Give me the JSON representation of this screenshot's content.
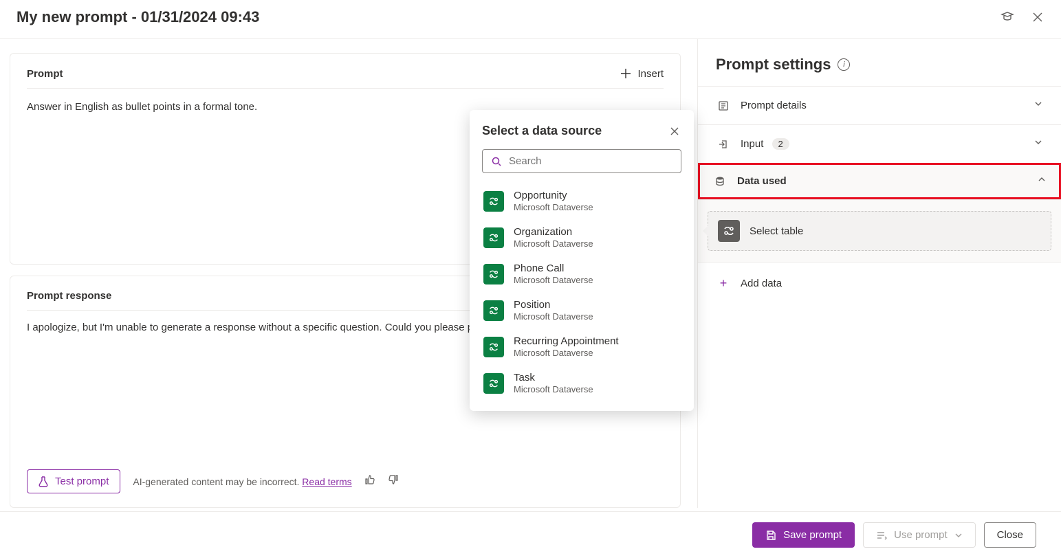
{
  "header": {
    "title": "My new prompt - 01/31/2024 09:43"
  },
  "prompt": {
    "section_title": "Prompt",
    "insert_label": "Insert",
    "text": "Answer in English as bullet points in a formal tone."
  },
  "response": {
    "section_title": "Prompt response",
    "text": "I apologize, but I'm unable to generate a response without a specific question. Could you please provide",
    "test_button": "Test prompt",
    "ai_note": "AI-generated content may be incorrect.",
    "read_terms": "Read terms"
  },
  "settings": {
    "title": "Prompt settings",
    "prompt_details": "Prompt details",
    "input_label": "Input",
    "input_count": "2",
    "data_used": "Data used",
    "select_table": "Select table",
    "add_data": "Add data"
  },
  "popover": {
    "title": "Select a data source",
    "search_placeholder": "Search",
    "items": [
      {
        "name": "Opportunity",
        "sub": "Microsoft Dataverse"
      },
      {
        "name": "Organization",
        "sub": "Microsoft Dataverse"
      },
      {
        "name": "Phone Call",
        "sub": "Microsoft Dataverse"
      },
      {
        "name": "Position",
        "sub": "Microsoft Dataverse"
      },
      {
        "name": "Recurring Appointment",
        "sub": "Microsoft Dataverse"
      },
      {
        "name": "Task",
        "sub": "Microsoft Dataverse"
      }
    ]
  },
  "footer": {
    "save": "Save prompt",
    "use": "Use prompt",
    "close": "Close"
  }
}
